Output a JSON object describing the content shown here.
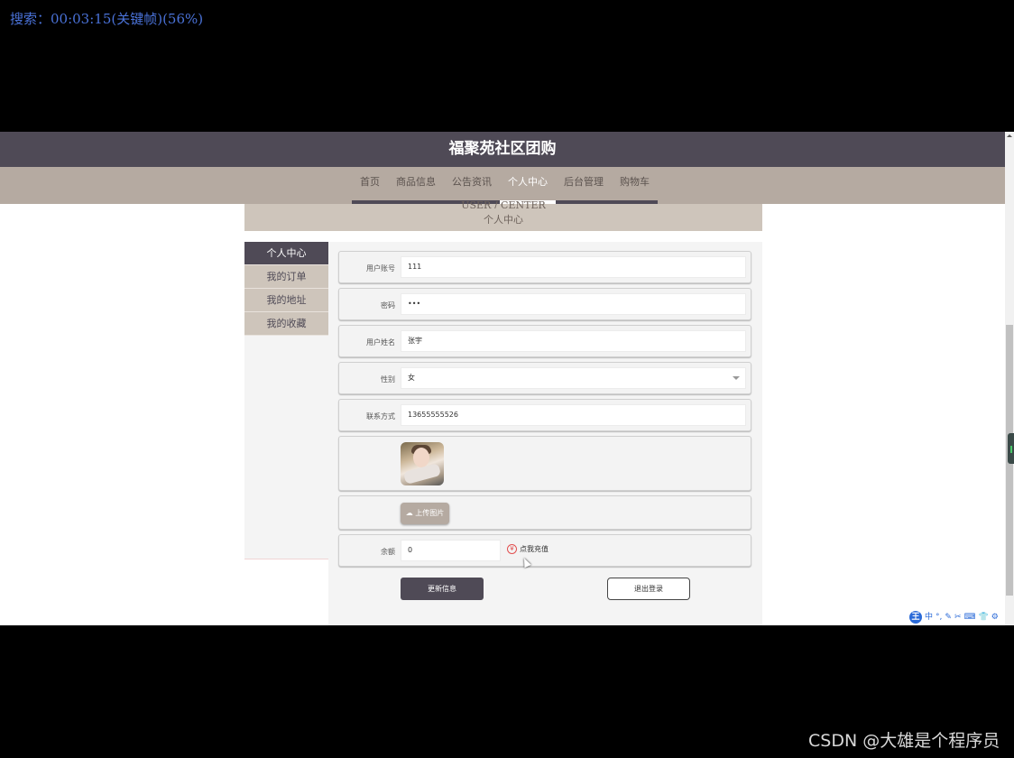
{
  "overlay": {
    "search_text": "搜索：00:03:15(关键帧)(56%)"
  },
  "site": {
    "title": "福聚苑社区团购"
  },
  "nav": {
    "items": [
      {
        "label": "首页",
        "active": false
      },
      {
        "label": "商品信息",
        "active": false
      },
      {
        "label": "公告资讯",
        "active": false
      },
      {
        "label": "个人中心",
        "active": true
      },
      {
        "label": "后台管理",
        "active": false
      },
      {
        "label": "购物车",
        "active": false
      }
    ]
  },
  "banner": {
    "en": "USER / CENTER",
    "cn": "个人中心"
  },
  "sidebar": {
    "items": [
      {
        "label": "个人中心",
        "active": true
      },
      {
        "label": "我的订单",
        "active": false
      },
      {
        "label": "我的地址",
        "active": false
      },
      {
        "label": "我的收藏",
        "active": false
      }
    ]
  },
  "form": {
    "fields": [
      {
        "label": "用户账号",
        "value": "111"
      },
      {
        "label": "密码",
        "value": "•••"
      },
      {
        "label": "用户姓名",
        "value": "张宇"
      },
      {
        "label": "性别",
        "value": "女"
      },
      {
        "label": "联系方式",
        "value": "13655555526"
      }
    ],
    "upload_label": "上传图片",
    "balance_label": "余额",
    "balance_value": "0",
    "recharge_label": "点我充值",
    "yen_symbol": "¥",
    "update_button": "更新信息",
    "logout_button": "退出登录"
  },
  "ime": {
    "logo": "王",
    "items": [
      "中",
      "°,",
      "✎",
      "✂",
      "⌨",
      "👕",
      "⚙"
    ]
  },
  "watermark": "CSDN @大雄是个程序员",
  "colors": {
    "header": "#4f4a56",
    "nav": "#b5aaa1",
    "banner": "#cec5bb",
    "overlay_text": "#4a72d8"
  }
}
